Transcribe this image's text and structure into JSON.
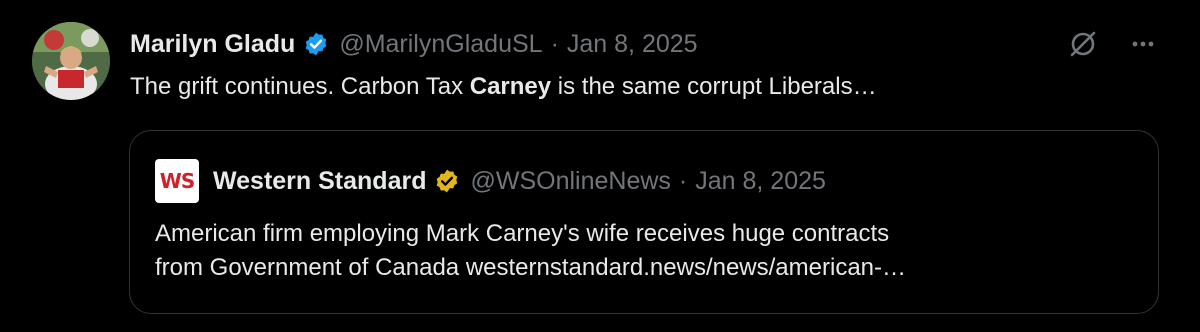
{
  "tweet": {
    "author_name": "Marilyn Gladu",
    "handle": "@MarilynGladuSL",
    "separator": "·",
    "date": "Jan 8, 2025",
    "text_before": "The grift continues. Carbon Tax ",
    "text_bold": "Carney",
    "text_after": " is the same corrupt Liberals…"
  },
  "quote": {
    "logo_text": "WS",
    "author_name": "Western Standard",
    "handle": "@WSOnlineNews",
    "separator": "·",
    "date": "Jan 8, 2025",
    "body_line1": "American firm employing Mark Carney's wife receives huge contracts",
    "body_line2": "from Government of Canada westernstandard.news/news/american-…"
  },
  "icons": {
    "verified_badge": "verified-badge-blue",
    "quote_verified_badge": "verified-badge-gold",
    "grok_icon": "grok-icon",
    "more_icon": "more-icon"
  },
  "colors": {
    "background": "#000000",
    "text": "#e7e9ea",
    "muted": "#71767b",
    "blue_badge": "#1d9bf0",
    "gold_badge": "#e2b719",
    "ws_red": "#d0202a"
  }
}
